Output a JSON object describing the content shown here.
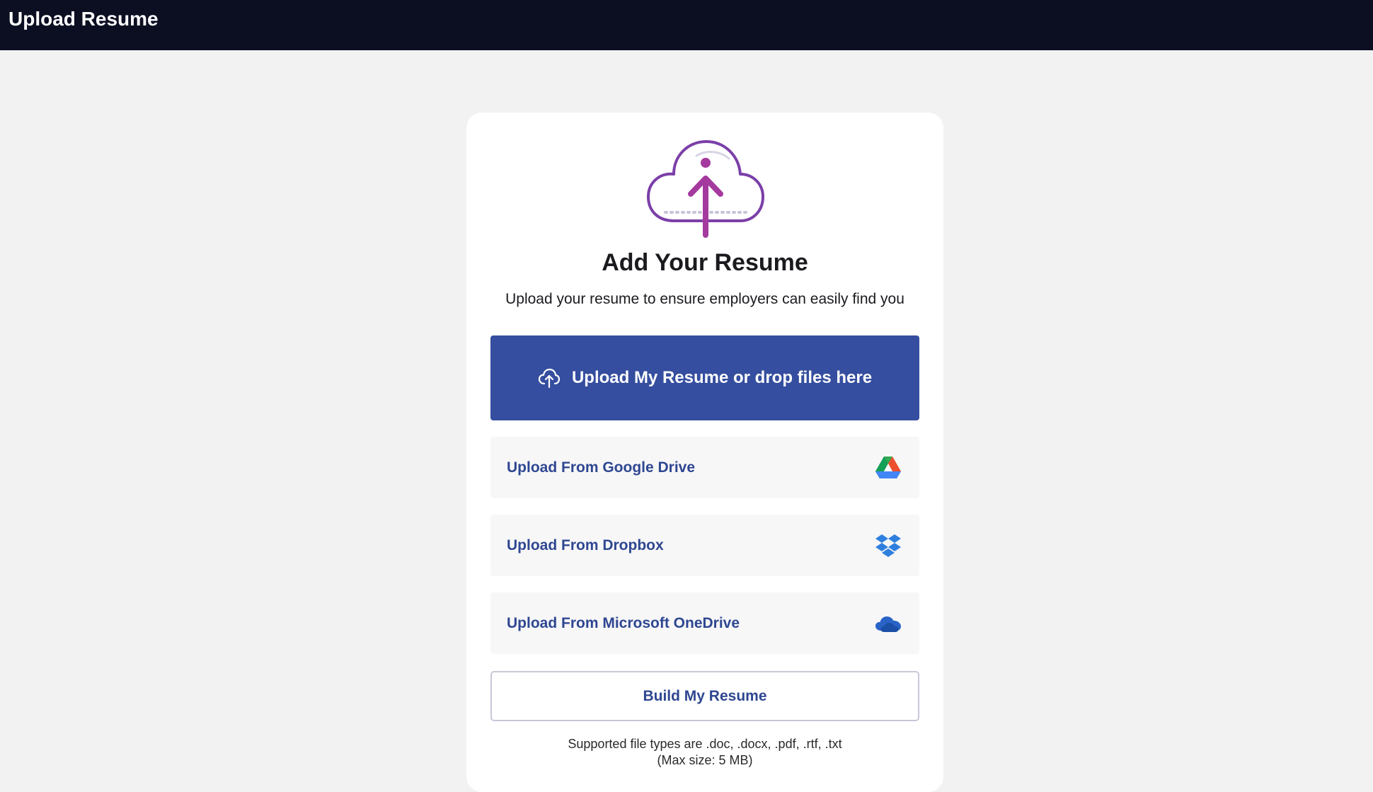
{
  "header": {
    "title": "Upload Resume"
  },
  "card": {
    "heading": "Add Your Resume",
    "subtitle": "Upload your resume to ensure employers can easily find you",
    "hero_icon": "cloud-upload-icon",
    "primary_button": {
      "label": "Upload My Resume or drop files here",
      "icon": "cloud-upload-icon"
    },
    "options": [
      {
        "label": "Upload From Google Drive",
        "icon": "google-drive-icon"
      },
      {
        "label": "Upload From Dropbox",
        "icon": "dropbox-icon"
      },
      {
        "label": "Upload From Microsoft OneDrive",
        "icon": "onedrive-icon"
      }
    ],
    "build_button": "Build My Resume",
    "note_line1": "Supported file types are .doc, .docx, .pdf, .rtf, .txt",
    "note_line2": "(Max size: 5 MB)"
  },
  "colors": {
    "header_bg": "#0c0e22",
    "page_bg": "#f2f2f2",
    "primary": "#354e9f",
    "link_text": "#2f4791",
    "accent_purple": "#7b3fa8",
    "accent_magenta": "#a4399e"
  }
}
